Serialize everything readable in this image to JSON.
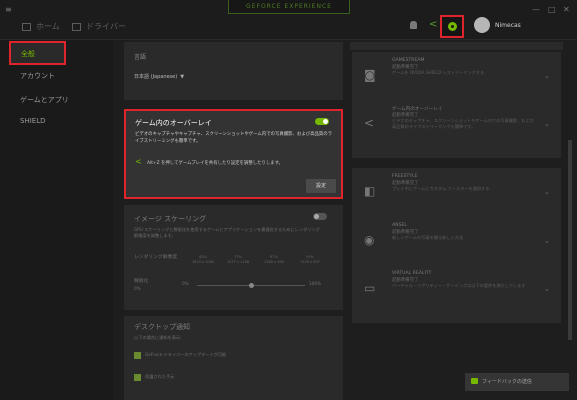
{
  "titlebar": {
    "brand": "GEFORCE EXPERIENCE",
    "tabs": [
      {
        "label": "ホーム"
      },
      {
        "label": "ドライバー"
      }
    ],
    "username": "Nimecas"
  },
  "sidebar": {
    "items": [
      {
        "label": "全般",
        "active": true
      },
      {
        "label": "アカウント"
      },
      {
        "label": "ゲームとアプリ"
      },
      {
        "label": "SHIELD"
      }
    ]
  },
  "language": {
    "title": "言語",
    "value": "日本語 (Japanese)"
  },
  "overlay": {
    "title": "ゲーム内のオーバーレイ",
    "description": "ビデオのキャプチャやキャプチャ、スクリーンショットやゲーム内での写真撮影、および高品質のライブストリーミングも簡単です。",
    "hint": "Alt+Z を押してゲームプレイを共有したり設定を調整したりします。",
    "settings_button": "設定",
    "enabled": true
  },
  "image_scaling": {
    "title": "イメージ スケーリング",
    "description": "GPU スケーリングと鮮鋭化を使用するゲームとアプリケーションを最適化するためにレンダリング解像度を調整します。",
    "render_label": "レンダリング解像度",
    "render_options": [
      {
        "pct": "85%",
        "res": "1920 x 1080"
      },
      {
        "pct": "77%",
        "res": "1477 x 1108"
      },
      {
        "pct": "67%",
        "res": "1280 x 960"
      },
      {
        "pct": "59%",
        "res": "1129 x 847"
      }
    ],
    "sharpen_label": "鮮鋭化",
    "sharpen_sub": "0%",
    "slider_min": "0%",
    "slider_max": "100%",
    "sharpen_value": 0.5,
    "enabled": false
  },
  "desktop_notifications": {
    "title": "デスクトップ通知",
    "description": "以下の場合に通知を表示:",
    "items": [
      {
        "label": "GeForce ドライバーのアップデートが可能"
      },
      {
        "label": "保護された手元"
      }
    ]
  },
  "right_panel": {
    "rows": [
      {
        "icon": "gamepad-icon",
        "title": "GAMESTREAM",
        "status": "起動準備完了",
        "desc": "ゲームを NVIDIA SHIELD へストリーミングする"
      },
      {
        "icon": "share-icon",
        "title": "ゲーム内のオーバーレイ",
        "status": "起動準備完了",
        "desc": "ビデオのキャプチャ、スクリーンショットやゲーム内での写真撮影、および高品質のライブストリーミングも簡単です。"
      },
      {
        "icon": "filter-icon",
        "title": "FREESTYLE",
        "status": "起動準備完了",
        "desc": "プレイ中にゲームにカスタム フィルターを適用する"
      },
      {
        "icon": "camera-icon",
        "title": "ANSEL",
        "status": "起動準備完了",
        "desc": "新しいゲームの写真を撮る新しい方法"
      },
      {
        "icon": "vr-headset-icon",
        "title": "VIRTUAL REALITY",
        "status": "起動準備完了",
        "desc": "バーチャル・リアリティー・ゲーミングは以下の要件を満たしています"
      }
    ]
  },
  "feedback": {
    "label": "フィードバックの送信"
  }
}
